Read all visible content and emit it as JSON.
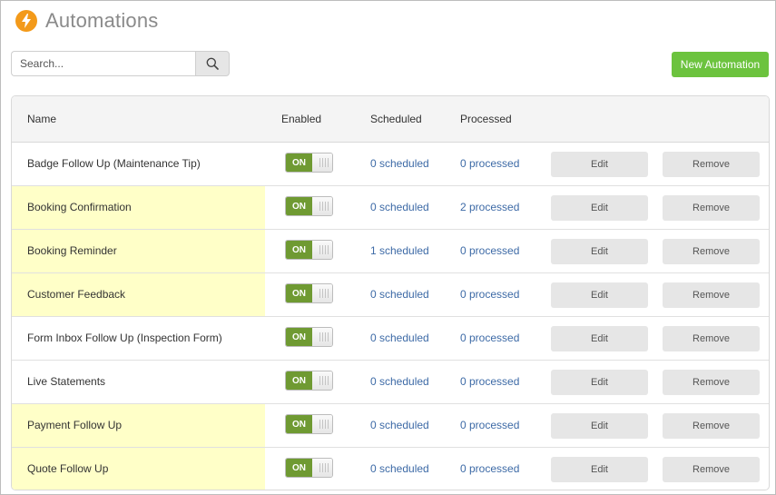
{
  "app": {
    "title": "Automations",
    "logo_icon": "bolt-icon",
    "accent": "#f39a1a"
  },
  "search": {
    "placeholder": "Search...",
    "value": "",
    "button_icon": "search-icon"
  },
  "toolbar": {
    "new_label": "New Automation",
    "new_color": "#6cc33e"
  },
  "table": {
    "columns": [
      "Name",
      "Enabled",
      "Scheduled",
      "Processed"
    ],
    "rows": [
      {
        "name": "Badge Follow Up (Maintenance Tip)",
        "enabled": "ON",
        "scheduled": "0 scheduled",
        "processed": "0 processed",
        "edit": "Edit",
        "remove": "Remove",
        "highlighted": false
      },
      {
        "name": "Booking Confirmation",
        "enabled": "ON",
        "scheduled": "0 scheduled",
        "processed": "2 processed",
        "edit": "Edit",
        "remove": "Remove",
        "highlighted": true
      },
      {
        "name": "Booking Reminder",
        "enabled": "ON",
        "scheduled": "1 scheduled",
        "processed": "0 processed",
        "edit": "Edit",
        "remove": "Remove",
        "highlighted": true
      },
      {
        "name": "Customer Feedback",
        "enabled": "ON",
        "scheduled": "0 scheduled",
        "processed": "0 processed",
        "edit": "Edit",
        "remove": "Remove",
        "highlighted": true
      },
      {
        "name": "Form Inbox Follow Up (Inspection Form)",
        "enabled": "ON",
        "scheduled": "0 scheduled",
        "processed": "0 processed",
        "edit": "Edit",
        "remove": "Remove",
        "highlighted": false
      },
      {
        "name": "Live Statements",
        "enabled": "ON",
        "scheduled": "0 scheduled",
        "processed": "0 processed",
        "edit": "Edit",
        "remove": "Remove",
        "highlighted": false
      },
      {
        "name": "Payment Follow Up",
        "enabled": "ON",
        "scheduled": "0 scheduled",
        "processed": "0 processed",
        "edit": "Edit",
        "remove": "Remove",
        "highlighted": true
      },
      {
        "name": "Quote Follow Up",
        "enabled": "ON",
        "scheduled": "0 scheduled",
        "processed": "0 processed",
        "edit": "Edit",
        "remove": "Remove",
        "highlighted": true
      }
    ]
  },
  "colors": {
    "highlight": "#ffffc8",
    "toggle_on": "#6f9a32",
    "link": "#3d6aa6"
  }
}
